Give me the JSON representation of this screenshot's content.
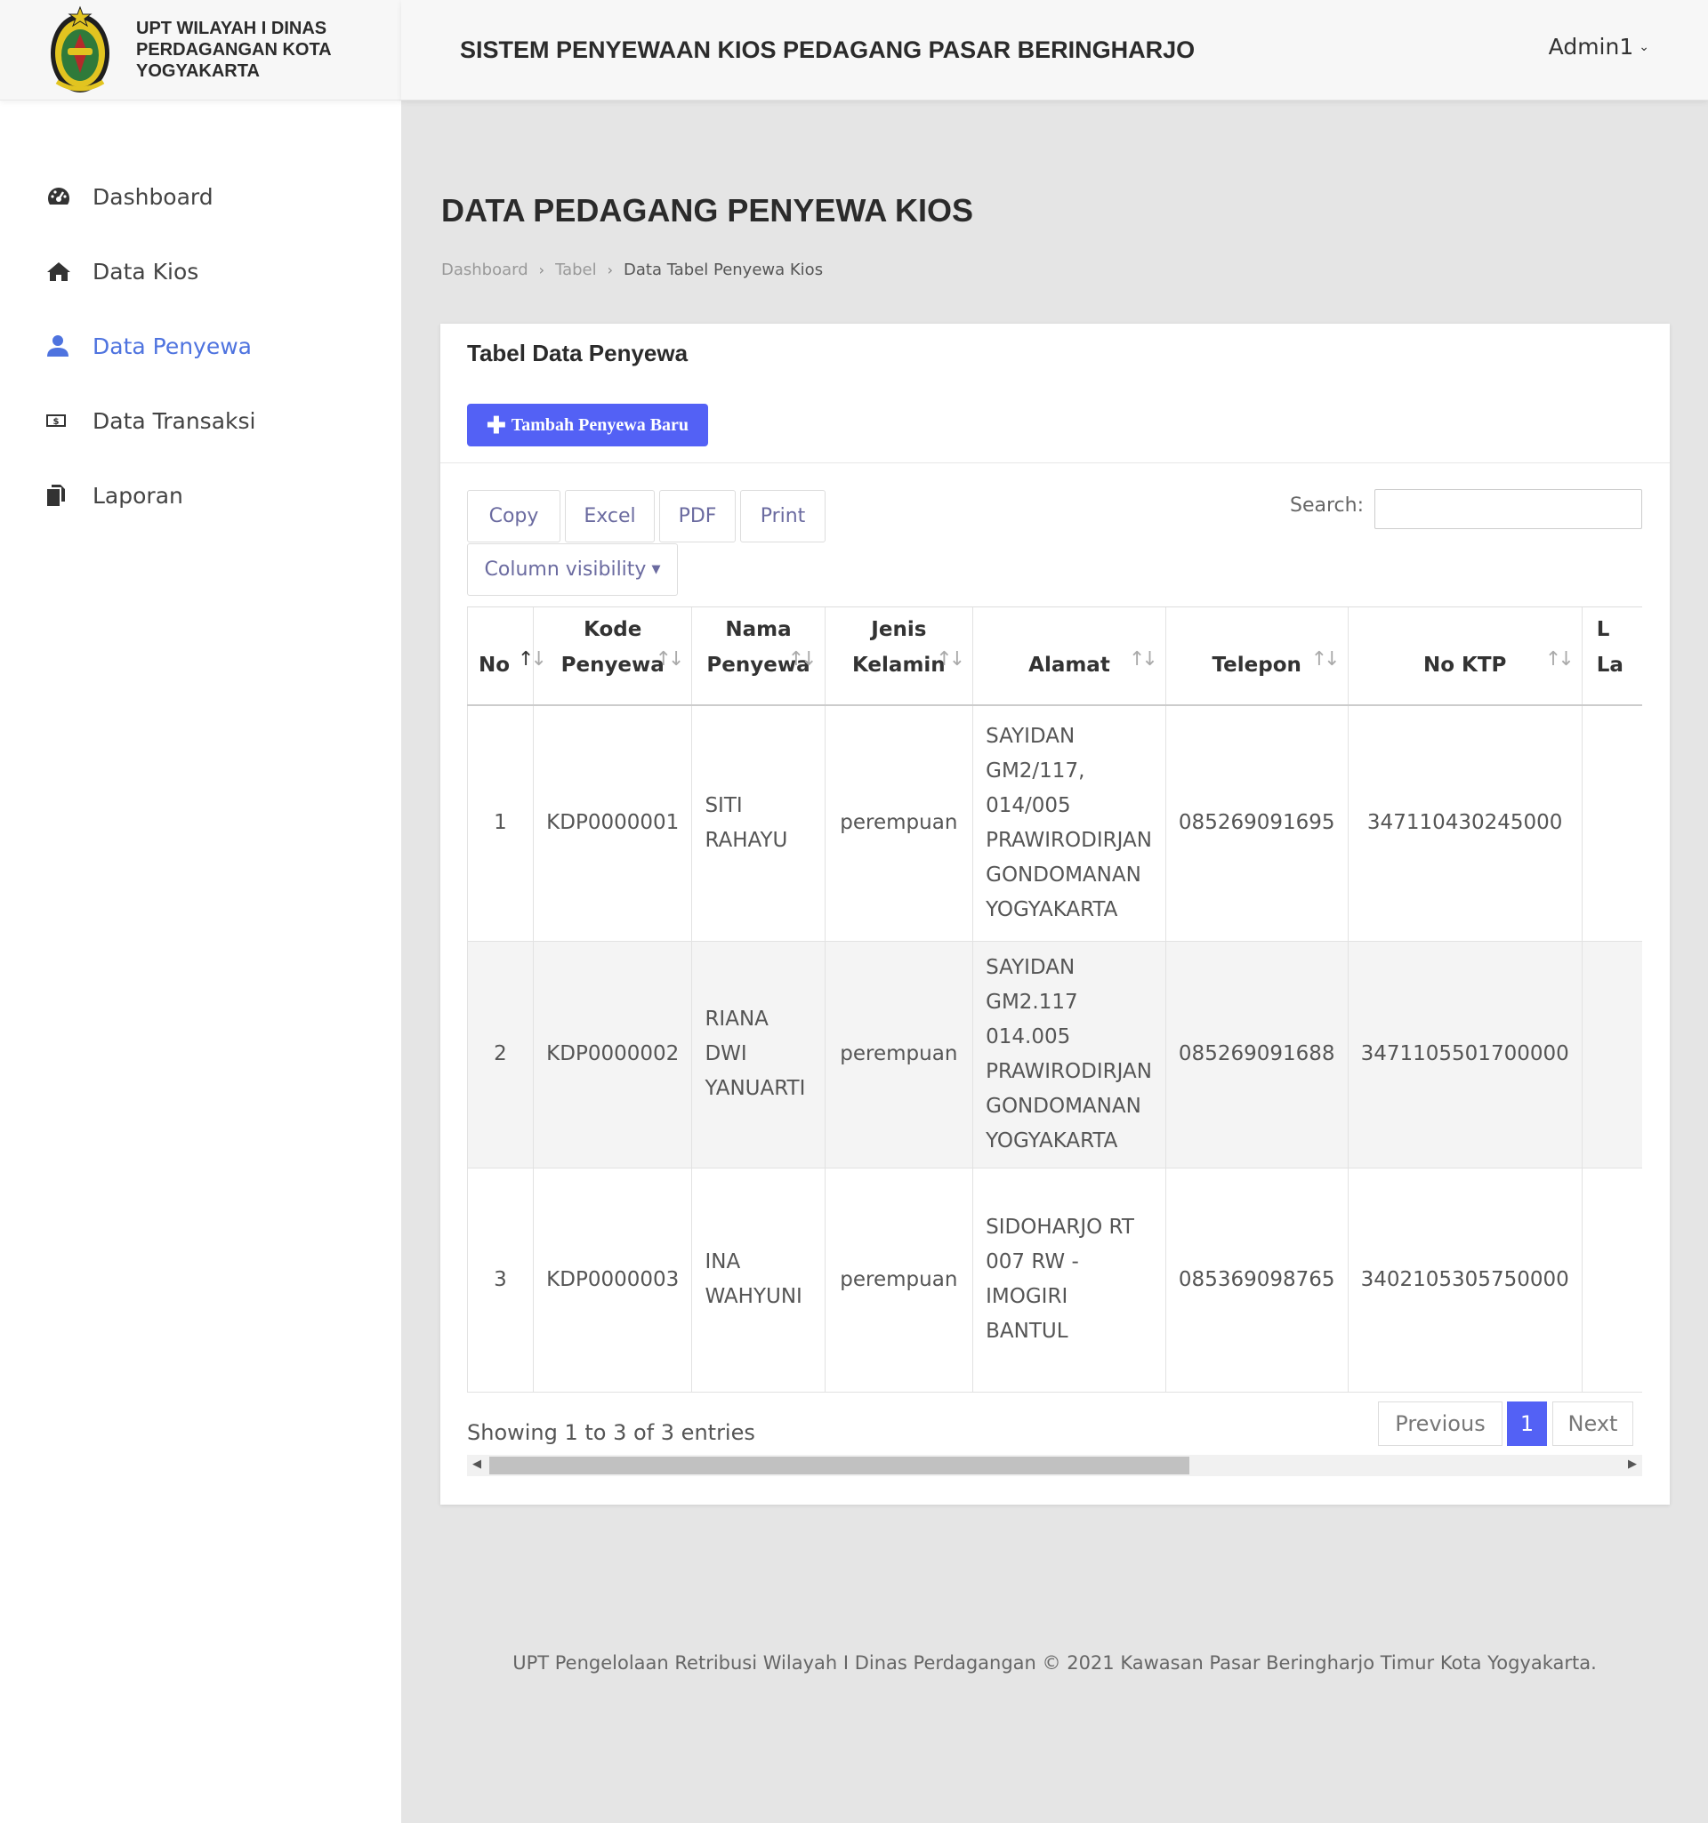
{
  "brand": {
    "logo": "coat-of-arms-logo",
    "name": "UPT WILAYAH I DINAS\nPERDAGANGAN KOTA\nYOGYAKARTA"
  },
  "header": {
    "title": "SISTEM PENYEWAAN KIOS PEDAGANG PASAR BERINGHARJO",
    "user": "Admin1"
  },
  "sidebar": {
    "items": [
      {
        "label": "Dashboard",
        "icon": "tachometer-icon"
      },
      {
        "label": "Data Kios",
        "icon": "home-icon"
      },
      {
        "label": "Data Penyewa",
        "icon": "user-icon",
        "active": true
      },
      {
        "label": "Data Transaksi",
        "icon": "money-bill-icon"
      },
      {
        "label": "Laporan",
        "icon": "copy-icon"
      }
    ]
  },
  "page": {
    "title": "DATA PEDAGANG PENYEWA KIOS",
    "breadcrumb": [
      "Dashboard",
      "Tabel",
      "Data Tabel Penyewa Kios"
    ]
  },
  "card": {
    "title": "Tabel Data Penyewa",
    "add_button": "Tambah Penyewa Baru",
    "export_buttons": [
      "Copy",
      "Excel",
      "PDF",
      "Print"
    ],
    "column_visibility": "Column visibility",
    "search_label": "Search:",
    "search_value": ""
  },
  "table": {
    "columns": [
      {
        "line1": "",
        "line2": "No"
      },
      {
        "line1": "Kode",
        "line2": "Penyewa"
      },
      {
        "line1": "Nama",
        "line2": "Penyewa"
      },
      {
        "line1": "Jenis",
        "line2": "Kelamin"
      },
      {
        "line1": "",
        "line2": "Alamat"
      },
      {
        "line1": "",
        "line2": "Telepon"
      },
      {
        "line1": "",
        "line2": "No KTP"
      },
      {
        "line1": "L",
        "line2": "La"
      }
    ],
    "rows": [
      [
        "1",
        "KDP0000001",
        "SITI\nRAHAYU",
        "perempuan",
        "SAYIDAN\nGM2/117,\n014/005\nPRAWIRODIRJAN\nGONDOMANAN\nYOGYAKARTA",
        "085269091695",
        "347110430245000",
        ""
      ],
      [
        "2",
        "KDP0000002",
        "RIANA DWI\nYANUARTI",
        "perempuan",
        "SAYIDAN\nGM2.117 014.005\nPRAWIRODIRJAN\nGONDOMANAN\nYOGYAKARTA",
        "085269091688",
        "3471105501700000",
        ""
      ],
      [
        "3",
        "KDP0000003",
        "INA\nWAHYUNI",
        "perempuan",
        "SIDOHARJO RT\n007 RW -\nIMOGIRI BANTUL",
        "085369098765",
        "3402105305750000",
        ""
      ]
    ]
  },
  "pagination": {
    "info": "Showing 1 to 3 of 3 entries",
    "previous": "Previous",
    "current": "1",
    "next": "Next"
  },
  "footer": {
    "text": "UPT Pengelolaan Retribusi Wilayah I Dinas Perdagangan © 2021 Kawasan Pasar Beringharjo Timur Kota Yogyakarta."
  },
  "colors": {
    "accent": "#5361f5",
    "active_nav": "#4e73df",
    "background": "#e5e5e5"
  }
}
